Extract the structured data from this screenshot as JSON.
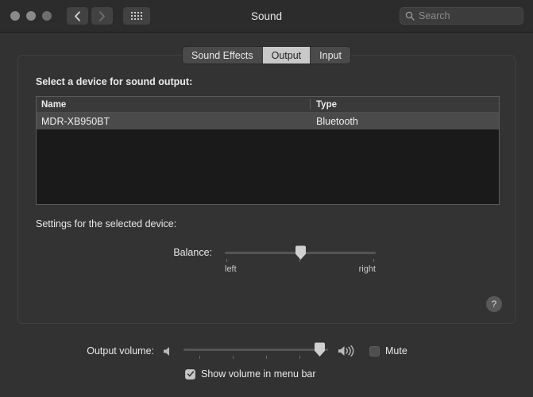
{
  "window": {
    "title": "Sound",
    "traffic_lights": [
      "close",
      "minimize",
      "maximize"
    ]
  },
  "toolbar": {
    "back_icon": "chevron-left-icon",
    "forward_icon": "chevron-right-icon",
    "grid_icon": "show-all-grid-icon",
    "search": {
      "icon": "search-icon",
      "placeholder": "Search",
      "value": ""
    }
  },
  "tabs": [
    {
      "label": "Sound Effects",
      "active": false
    },
    {
      "label": "Output",
      "active": true
    },
    {
      "label": "Input",
      "active": false
    }
  ],
  "output_pane": {
    "device_prompt": "Select a device for sound output:",
    "table": {
      "columns": [
        "Name",
        "Type"
      ],
      "rows": [
        {
          "name": "MDR-XB950BT",
          "type": "Bluetooth",
          "selected": true
        }
      ]
    },
    "settings_label": "Settings for the selected device:",
    "balance": {
      "label": "Balance:",
      "left_label": "left",
      "right_label": "right",
      "value_percent": 50
    },
    "help_button": "?"
  },
  "footer": {
    "output_volume_label": "Output volume:",
    "low_volume_icon": "speaker-low-icon",
    "high_volume_icon": "speaker-high-icon",
    "volume_percent": 94,
    "mute": {
      "label": "Mute",
      "checked": false
    },
    "show_in_menu_bar": {
      "label": "Show volume in menu bar",
      "checked": true
    }
  },
  "colors": {
    "window_bg": "#323232",
    "titlebar_bg": "#2c2c2c",
    "panel_bg": "#333333",
    "list_bg": "#1a1a1a",
    "selected_row": "#4a4a4a",
    "active_tab": "#c9c9c9",
    "text": "#e9e9e9"
  }
}
